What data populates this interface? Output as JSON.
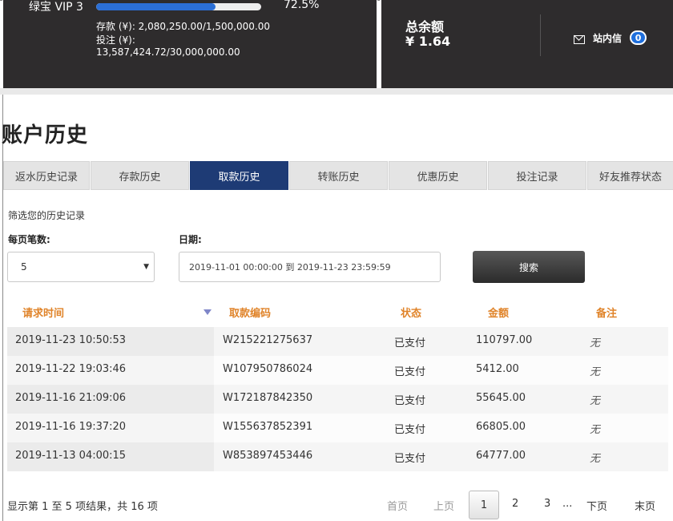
{
  "header": {
    "vip_label": "绿宝 VIP 3",
    "vip_progress": 0.725,
    "vip_percent": "72.5%",
    "deposit_line": "存款 (¥): 2,080,250.00/1,500,000.00",
    "bet_label": "投注 (¥):",
    "bet_value": "13,587,424.72/30,000,000.00",
    "balance_title": "总余额",
    "balance_value": "¥ 1.64",
    "mail_label": "站内信",
    "mail_count": "0"
  },
  "page": {
    "title": "账户历史"
  },
  "tabs": [
    {
      "label": "返水历史记录",
      "active": false
    },
    {
      "label": "存款历史",
      "active": false
    },
    {
      "label": "取款历史",
      "active": true
    },
    {
      "label": "转账历史",
      "active": false
    },
    {
      "label": "优惠历史",
      "active": false
    },
    {
      "label": "投注记录",
      "active": false
    },
    {
      "label": "好友推荐状态",
      "active": false
    }
  ],
  "filter": {
    "hint": "筛选您的历史记录",
    "per_page_label": "每页笔数:",
    "per_page_value": "5",
    "date_label": "日期:",
    "date_value": "2019-11-01 00:00:00 到 2019-11-23 23:59:59",
    "search_label": "搜索"
  },
  "table": {
    "headers": [
      "请求时间",
      "取款编码",
      "状态",
      "金额",
      "备注"
    ],
    "rows": [
      [
        "2019-11-23 10:50:53",
        "W215221275637",
        "已支付",
        "110797.00",
        "无"
      ],
      [
        "2019-11-22 19:03:46",
        "W107950786024",
        "已支付",
        "5412.00",
        "无"
      ],
      [
        "2019-11-16 21:09:06",
        "W172187842350",
        "已支付",
        "55645.00",
        "无"
      ],
      [
        "2019-11-16 19:37:20",
        "W155637852391",
        "已支付",
        "66805.00",
        "无"
      ],
      [
        "2019-11-13 04:00:15",
        "W853897453446",
        "已支付",
        "64777.00",
        "无"
      ]
    ]
  },
  "pagination": {
    "summary": "显示第 1 至 5 项结果，共 16 项",
    "first": "首页",
    "prev": "上页",
    "pages": [
      "1",
      "2",
      "3"
    ],
    "ellipsis": "...",
    "next": "下页",
    "last": "末页"
  },
  "colors": {
    "header_bg": "#2e2c2d",
    "tab_active": "#1e3b75",
    "progress": "#2b6fd6",
    "table_header": "#e0842a"
  }
}
